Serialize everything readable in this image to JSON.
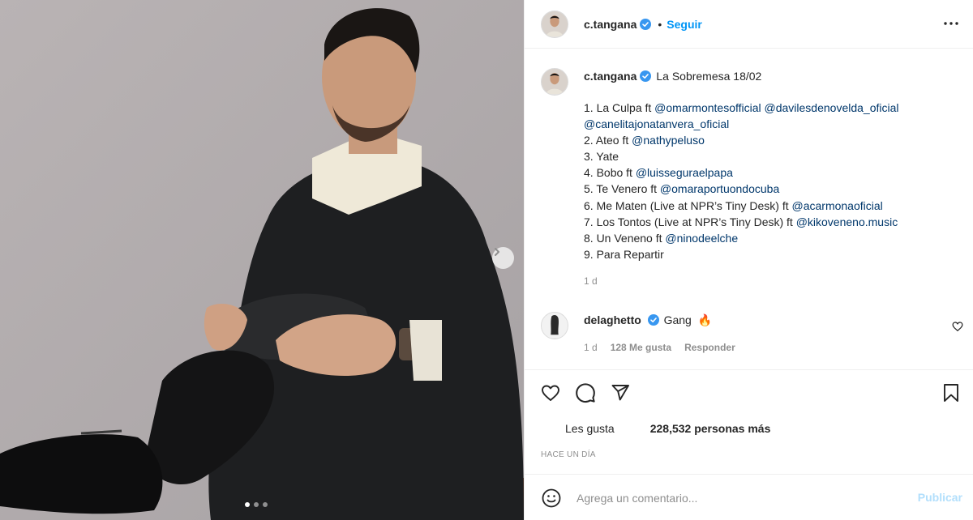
{
  "post": {
    "username": "c.tangana",
    "verified": true,
    "separator": "•",
    "follow_label": "Seguir",
    "more_icon": "more-horizontal-icon"
  },
  "caption": {
    "username": "c.tangana",
    "title": "La Sobremesa 18/02",
    "tracks": [
      {
        "text": "1. La Culpa ft ",
        "mentions": "@omarmontesofficial @davilesdenovelda_oficial"
      },
      {
        "text": "",
        "mentions": "@canelitajonatanvera_oficial"
      },
      {
        "text": "2. Ateo ft ",
        "mentions": "@nathypeluso"
      },
      {
        "text": "3. Yate",
        "mentions": ""
      },
      {
        "text": "4. Bobo ft ",
        "mentions": "@luisseguraelpapa"
      },
      {
        "text": "5. Te Venero ft ",
        "mentions": "@omaraportuondocuba"
      },
      {
        "text": "6. Me Maten (Live at NPR’s Tiny Desk) ft ",
        "mentions": "@acarmonaoficial"
      },
      {
        "text": "7. Los Tontos (Live at NPR’s Tiny Desk) ft ",
        "mentions": "@kikoveneno.music"
      },
      {
        "text": "8. Un Veneno ft ",
        "mentions": "@ninodeelche"
      },
      {
        "text": "9. Para Repartir",
        "mentions": ""
      }
    ],
    "time": "1 d"
  },
  "comment": {
    "username": "delaghetto",
    "text": "Gang",
    "emoji": "🔥",
    "time": "1 d",
    "likes": "128 Me gusta",
    "reply": "Responder"
  },
  "actions": {
    "like_icon": "heart-icon",
    "comment_icon": "comment-icon",
    "share_icon": "send-icon",
    "save_icon": "bookmark-icon"
  },
  "likes": {
    "label": "Les gusta",
    "count": "228,532 personas más"
  },
  "timeago": "HACE UN DÍA",
  "add_comment": {
    "placeholder": "Agrega un comentario...",
    "publish_label": "Publicar"
  },
  "carousel": {
    "dots": 3,
    "active": 0
  },
  "colors": {
    "accent": "#0095f6",
    "mention": "#00376b",
    "muted": "#8e8e8e",
    "publish_disabled": "#b2dffc",
    "verified": "#3897f0"
  }
}
